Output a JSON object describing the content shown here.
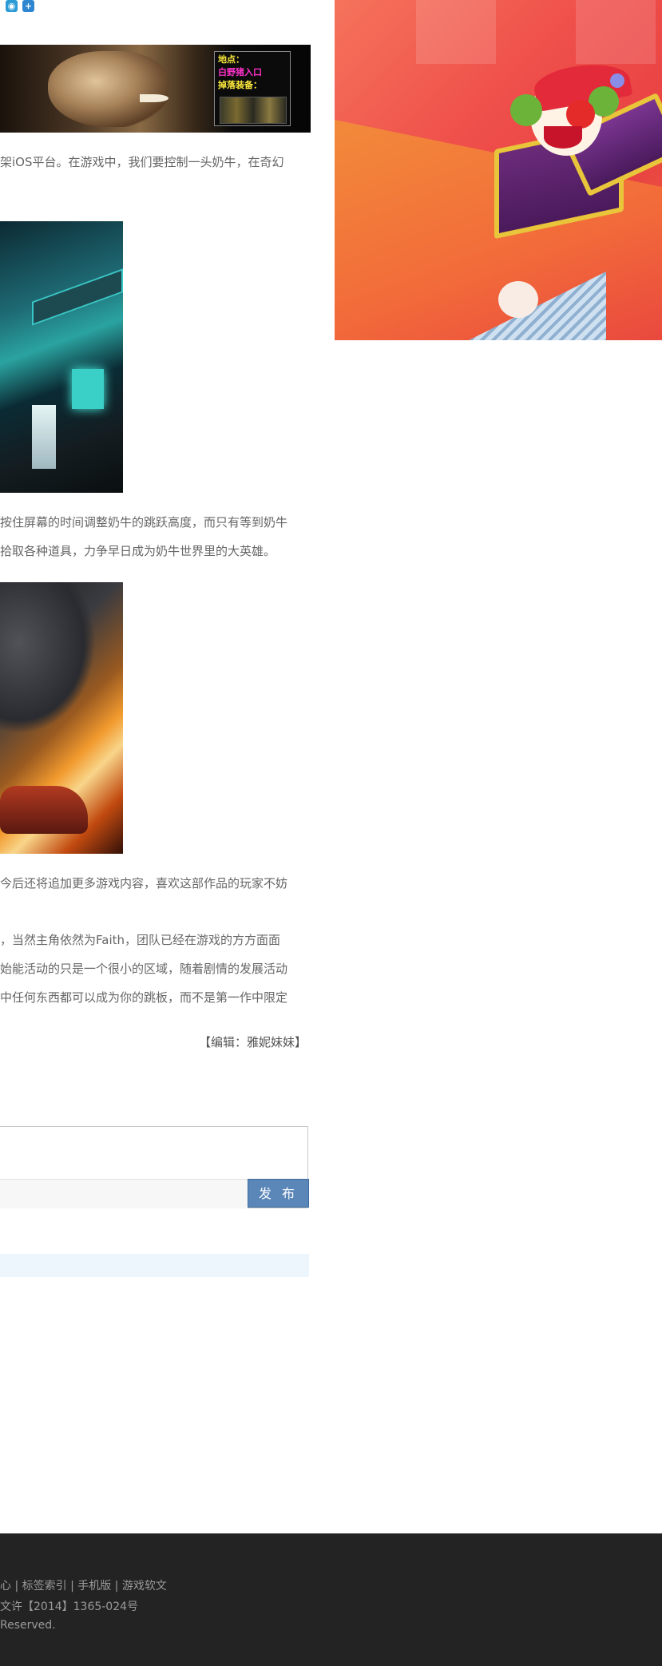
{
  "share": {
    "icons": [
      "qzone-icon",
      "share-plus-icon"
    ]
  },
  "banner": {
    "location_label": "地点：",
    "location_value": "白野猪入口",
    "drops_label": "掉落装备："
  },
  "article": {
    "para1": "架iOS平台。在游戏中，我们要控制一头奶牛，在奇幻",
    "para2_line1": "按住屏幕的时间调整奶牛的跳跃高度，而只有等到奶牛",
    "para2_line2": "拾取各种道具，力争早日成为奶牛世界里的大英雄。",
    "para3": "今后还将追加更多游戏内容，喜欢这部作品的玩家不妨",
    "para4_line1": "，当然主角依然为Faith，团队已经在游戏的方方面面",
    "para4_line2": "始能活动的只是一个很小的区域，随着剧情的发展活动",
    "para4_line3": "中任何东西都可以成为你的跳板，而不是第一作中限定",
    "editor": "【编辑：雅妮妹妹】"
  },
  "comment": {
    "publish_label": "发 布"
  },
  "footer": {
    "links": "心 | 标签索引 | 手机版 | 游戏软文",
    "license": "文许【2014】1365-024号",
    "rights": "Reserved."
  },
  "colors": {
    "publish_button": "#5a86b8",
    "footer_bg": "#232323",
    "strip": "#eef6fd"
  }
}
